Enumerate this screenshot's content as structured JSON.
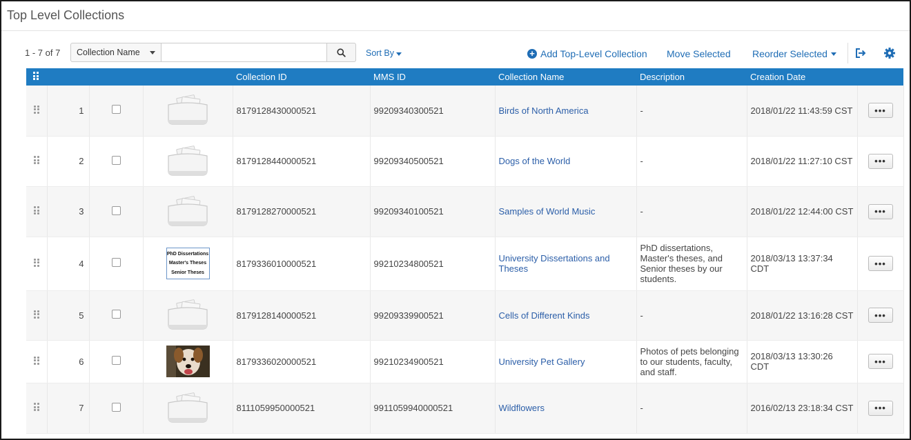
{
  "page": {
    "title": "Top Level Collections"
  },
  "toolbar": {
    "count": "1 - 7 of 7",
    "search_field": "Collection Name",
    "search_value": "",
    "sort_by": "Sort By",
    "add_label": "Add Top-Level Collection",
    "move_label": "Move Selected",
    "reorder_label": "Reorder Selected"
  },
  "icons": {
    "search": "search-icon",
    "add": "plus-circle-icon",
    "export": "export-icon",
    "settings": "gear-icon",
    "drag": "drag-handle-icon",
    "actions": "ellipsis-icon"
  },
  "colors": {
    "accent": "#1f7cc2",
    "link": "#2b5ea8"
  },
  "table": {
    "headers": {
      "collection_id": "Collection ID",
      "mms_id": "MMS ID",
      "collection_name": "Collection Name",
      "description": "Description",
      "creation_date": "Creation Date"
    },
    "rows": [
      {
        "index": "1",
        "thumbnail": "default",
        "collection_id": "8179128430000521",
        "mms_id": "99209340300521",
        "name": "Birds of North America",
        "description": "-",
        "created": "2018/01/22 11:43:59 CST",
        "actions": "•••"
      },
      {
        "index": "2",
        "thumbnail": "default",
        "collection_id": "8179128440000521",
        "mms_id": "99209340500521",
        "name": "Dogs of the World",
        "description": "-",
        "created": "2018/01/22 11:27:10 CST",
        "actions": "•••"
      },
      {
        "index": "3",
        "thumbnail": "default",
        "collection_id": "8179128270000521",
        "mms_id": "99209340100521",
        "name": "Samples of World Music",
        "description": "-",
        "created": "2018/01/22 12:44:00 CST",
        "actions": "•••"
      },
      {
        "index": "4",
        "thumbnail": "text",
        "thumb_lines": [
          "PhD Dissertations",
          "Master's Theses",
          "Senior Theses"
        ],
        "collection_id": "8179336010000521",
        "mms_id": "99210234800521",
        "name": "University Dissertations and Theses",
        "description": "PhD dissertations, Master's theses, and Senior theses by our students.",
        "created": "2018/03/13 13:37:34 CDT",
        "actions": "•••"
      },
      {
        "index": "5",
        "thumbnail": "default",
        "collection_id": "8179128140000521",
        "mms_id": "99209339900521",
        "name": "Cells of Different Kinds",
        "description": "-",
        "created": "2018/01/22 13:16:28 CST",
        "actions": "•••"
      },
      {
        "index": "6",
        "thumbnail": "photo",
        "collection_id": "8179336020000521",
        "mms_id": "99210234900521",
        "name": "University Pet Gallery",
        "description": "Photos of pets belonging to our students, faculty, and staff.",
        "created": "2018/03/13 13:30:26 CDT",
        "actions": "•••"
      },
      {
        "index": "7",
        "thumbnail": "default",
        "collection_id": "8111059950000521",
        "mms_id": "9911059940000521",
        "name": "Wildflowers",
        "description": "-",
        "created": "2016/02/13 23:18:34 CST",
        "actions": "•••"
      }
    ]
  }
}
